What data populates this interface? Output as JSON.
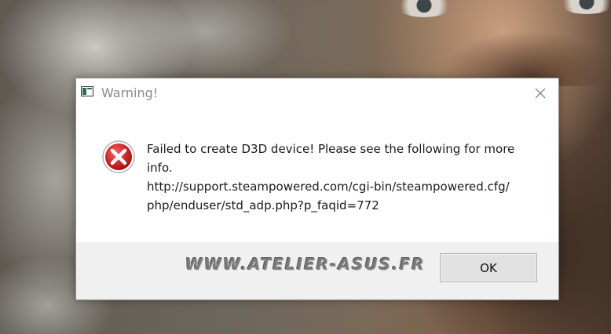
{
  "dialog": {
    "title": "Warning!",
    "message_lines": [
      "Failed to create D3D device! Please see the following for more",
      "info.",
      "http://support.steampowered.com/cgi-bin/steampowered.cfg/",
      "php/enduser/std_adp.php?p_faqid=772"
    ],
    "ok_label": "OK",
    "icon": "error-icon",
    "title_icon": "app-window-icon",
    "close_icon": "close-icon"
  },
  "watermark": {
    "text": "WWW.ATELIER-ASUS.FR"
  },
  "colors": {
    "error_red": "#d12a2a",
    "footer_bg": "#f0f0f0",
    "title_text": "#8a8a8a"
  }
}
